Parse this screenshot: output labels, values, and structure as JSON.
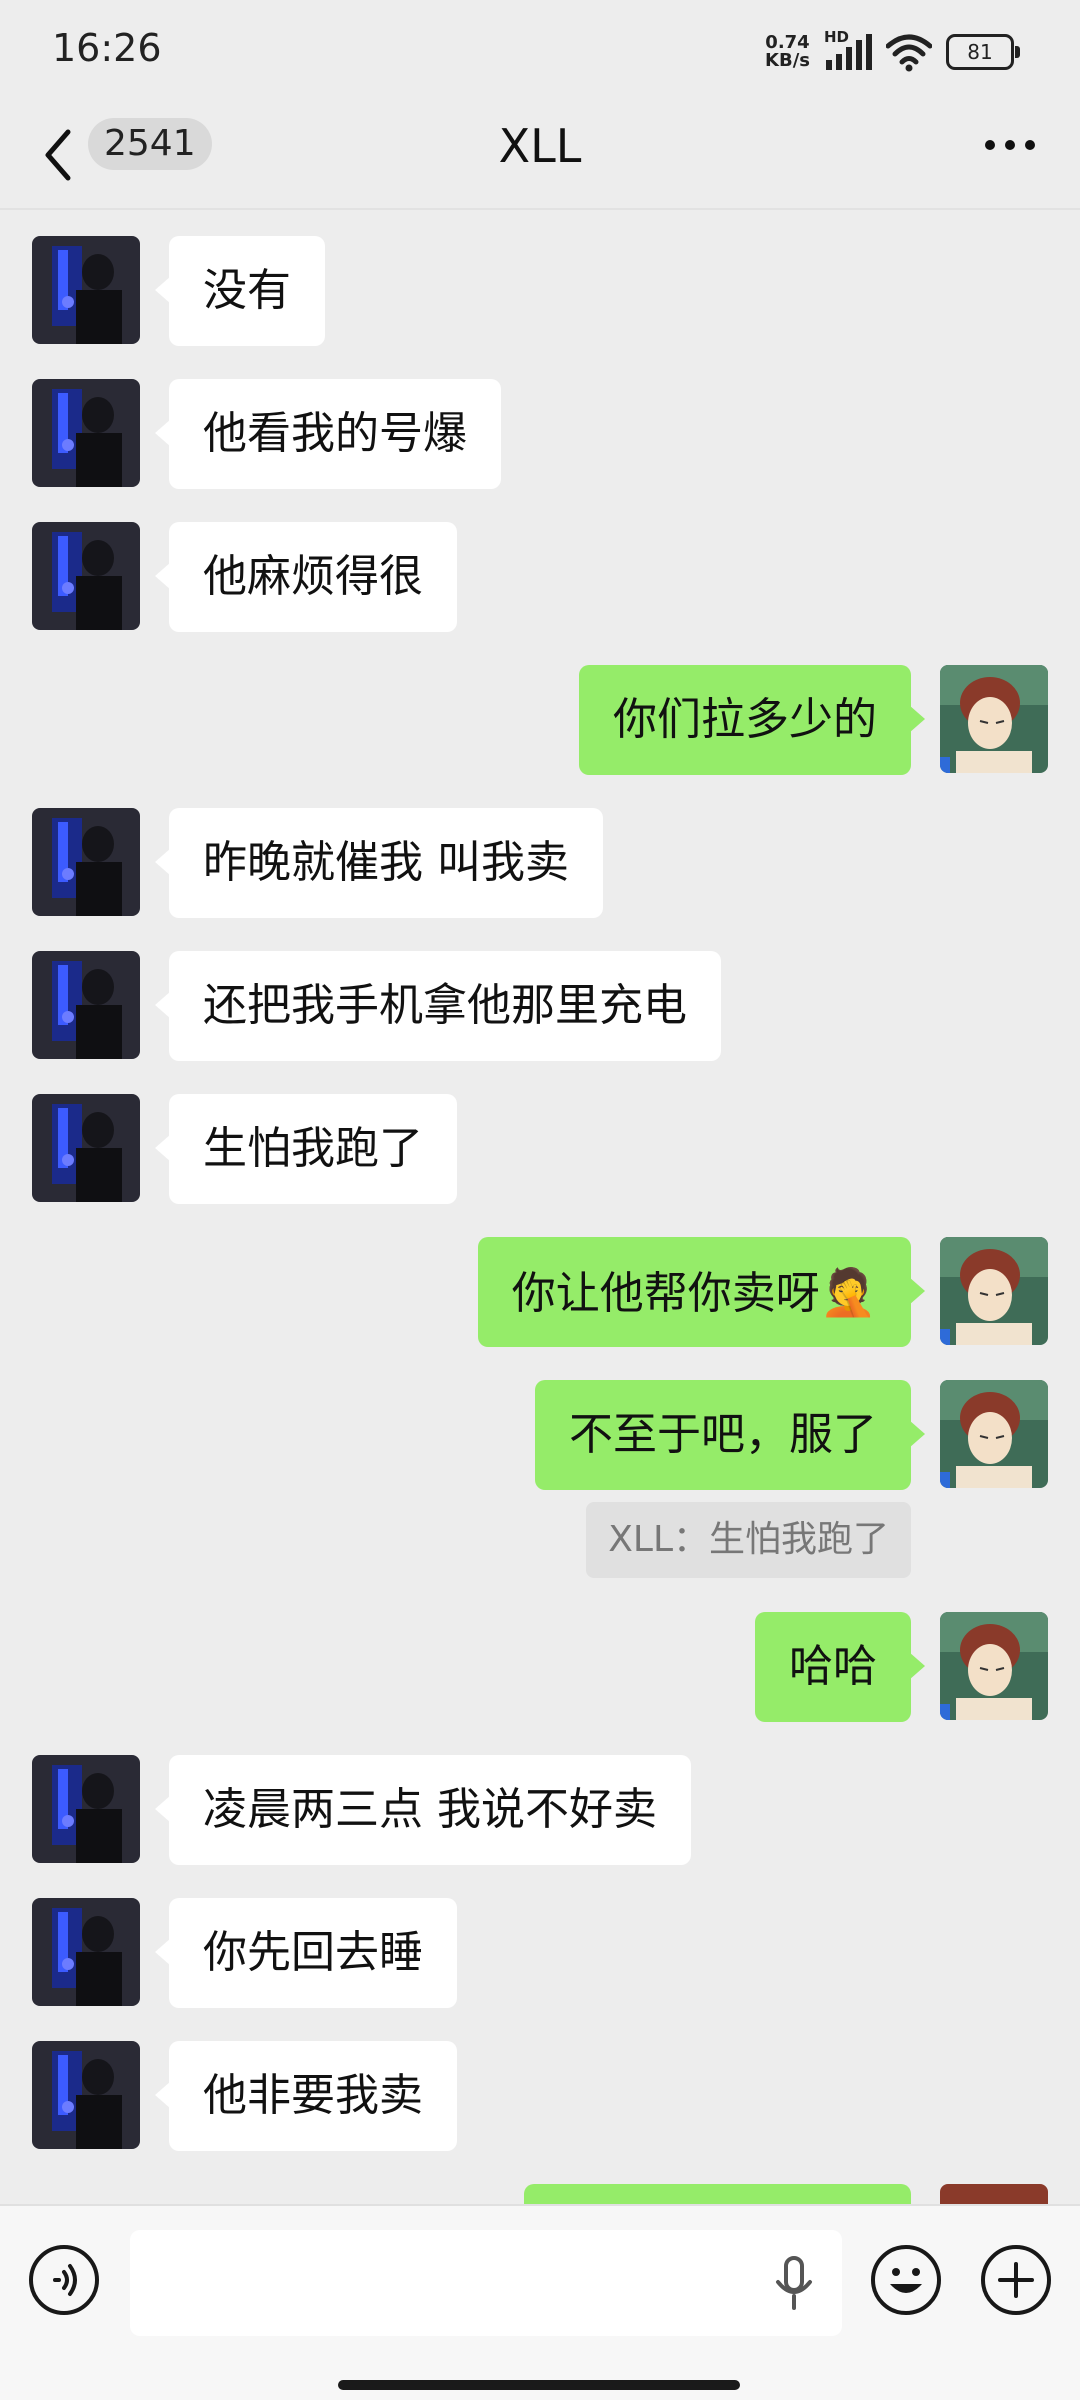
{
  "status_bar": {
    "time": "16:26",
    "net_speed_value": "0.74",
    "net_speed_unit": "KB/s",
    "hd_label": "HD",
    "battery": "81"
  },
  "header": {
    "unread_count": "2541",
    "title": "XLL"
  },
  "messages": [
    {
      "side": "in",
      "text": "没有"
    },
    {
      "side": "in",
      "text": "他看我的号爆"
    },
    {
      "side": "in",
      "text": "他麻烦得很"
    },
    {
      "side": "out",
      "text": "你们拉多少的"
    },
    {
      "side": "in",
      "text": "昨晚就催我 叫我卖"
    },
    {
      "side": "in",
      "text": "还把我手机拿他那里充电"
    },
    {
      "side": "in",
      "text": "生怕我跑了"
    },
    {
      "side": "out",
      "text": "你让他帮你卖呀",
      "emoji": "🤦"
    },
    {
      "side": "out",
      "text": "不至于吧，服了"
    },
    {
      "side": "out",
      "text": "哈哈"
    },
    {
      "side": "in",
      "text": "凌晨两三点  我说不好卖"
    },
    {
      "side": "in",
      "text": "你先回去睡"
    },
    {
      "side": "in",
      "text": "他非要我卖"
    }
  ],
  "quote": {
    "text": "XLL：生怕我跑了"
  },
  "input_bar": {
    "placeholder": ""
  },
  "icons": {
    "back": "chevron-left-icon",
    "more": "more-dots-icon",
    "voice": "voice-mode-icon",
    "mic": "microphone-icon",
    "emoji": "emoji-icon",
    "add": "plus-icon"
  },
  "colors": {
    "outgoing_bubble": "#95ec69",
    "incoming_bubble": "#ffffff",
    "background": "#ededed"
  }
}
